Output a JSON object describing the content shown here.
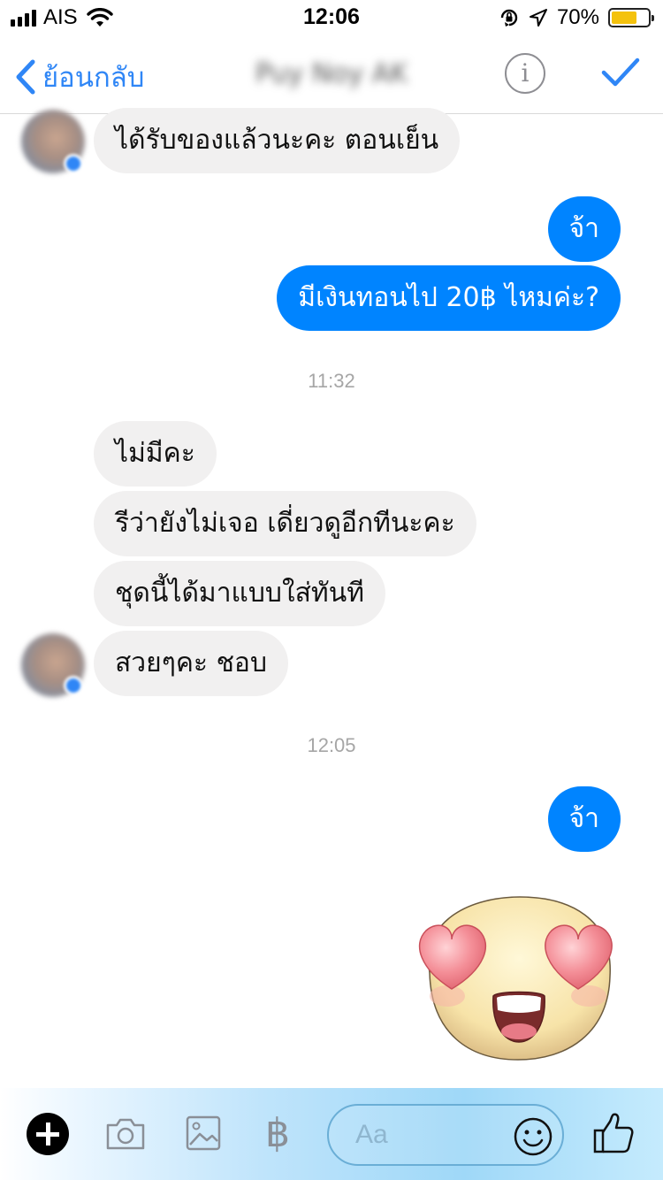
{
  "status_bar": {
    "carrier": "AIS",
    "time": "12:06",
    "battery_percent": "70%",
    "battery_level": 0.7,
    "battery_color": "#f4c20d"
  },
  "nav": {
    "back_label": "ย้อนกลับ",
    "contact_name": "Puy Noy AK",
    "info_label": "i",
    "accent_color": "#2f86f6"
  },
  "messages": [
    {
      "direction": "incoming",
      "text": "ได้รับของแล้วนะคะ ตอนเย็น"
    },
    {
      "direction": "outgoing",
      "text": "จ้า"
    },
    {
      "direction": "outgoing",
      "text": "มีเงินทอนไป 20฿ ไหมค่ะ?"
    },
    {
      "direction": "incoming",
      "text": "ไม่มีคะ"
    },
    {
      "direction": "incoming",
      "text": "รีว่ายังไม่เจอ เดี่ยวดูอีกทีนะคะ"
    },
    {
      "direction": "incoming",
      "text": "ชุดนี้ได้มาแบบใส่ทันที"
    },
    {
      "direction": "incoming",
      "text": "สวยๆคะ ชอบ"
    },
    {
      "direction": "outgoing",
      "text": "จ้า"
    },
    {
      "direction": "outgoing",
      "sticker": "heart-eyes-emoji"
    }
  ],
  "timestamps": [
    "11:32",
    "12:05"
  ],
  "colors": {
    "outgoing_bubble": "#0084ff",
    "incoming_bubble": "#f1f0f0"
  },
  "composer": {
    "placeholder": "Aa",
    "baht_symbol": "฿",
    "icons": [
      "plus-icon",
      "camera-icon",
      "image-icon",
      "baht-icon",
      "smiley-icon",
      "thumbs-up-icon"
    ]
  }
}
